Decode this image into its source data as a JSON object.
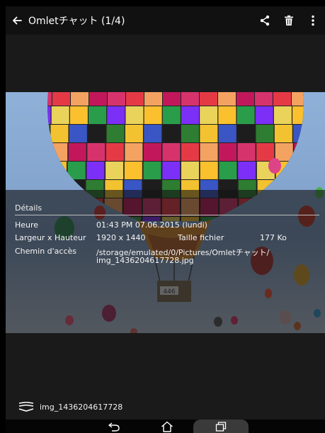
{
  "topbar": {
    "title": "Omletチャット (1/4)",
    "icons": [
      "back-arrow-icon",
      "share-icon",
      "trash-icon",
      "more-vert-icon"
    ]
  },
  "details": {
    "heading": "Détails",
    "time_label": "Heure",
    "time_value": "01:43 PM 07.06.2015 (lundi)",
    "dims_label": "Largeur x Hauteur",
    "dims_value": "1920 x 1440",
    "size_label": "Taille fichier",
    "size_value": "177 Ko",
    "path_label": "Chemin d'accès",
    "path_line1": "/storage/emulated/0/Pictures/Omletチャット/",
    "path_line2": "img_1436204617728.jpg"
  },
  "image": {
    "subject": "hot-air-balloon",
    "basket_number": "446"
  },
  "bottom": {
    "filename": "img_1436204617728",
    "icon": "layers-icon"
  },
  "navbar": {
    "icons": [
      "back-nav-icon",
      "home-nav-icon",
      "recents-nav-icon"
    ]
  }
}
